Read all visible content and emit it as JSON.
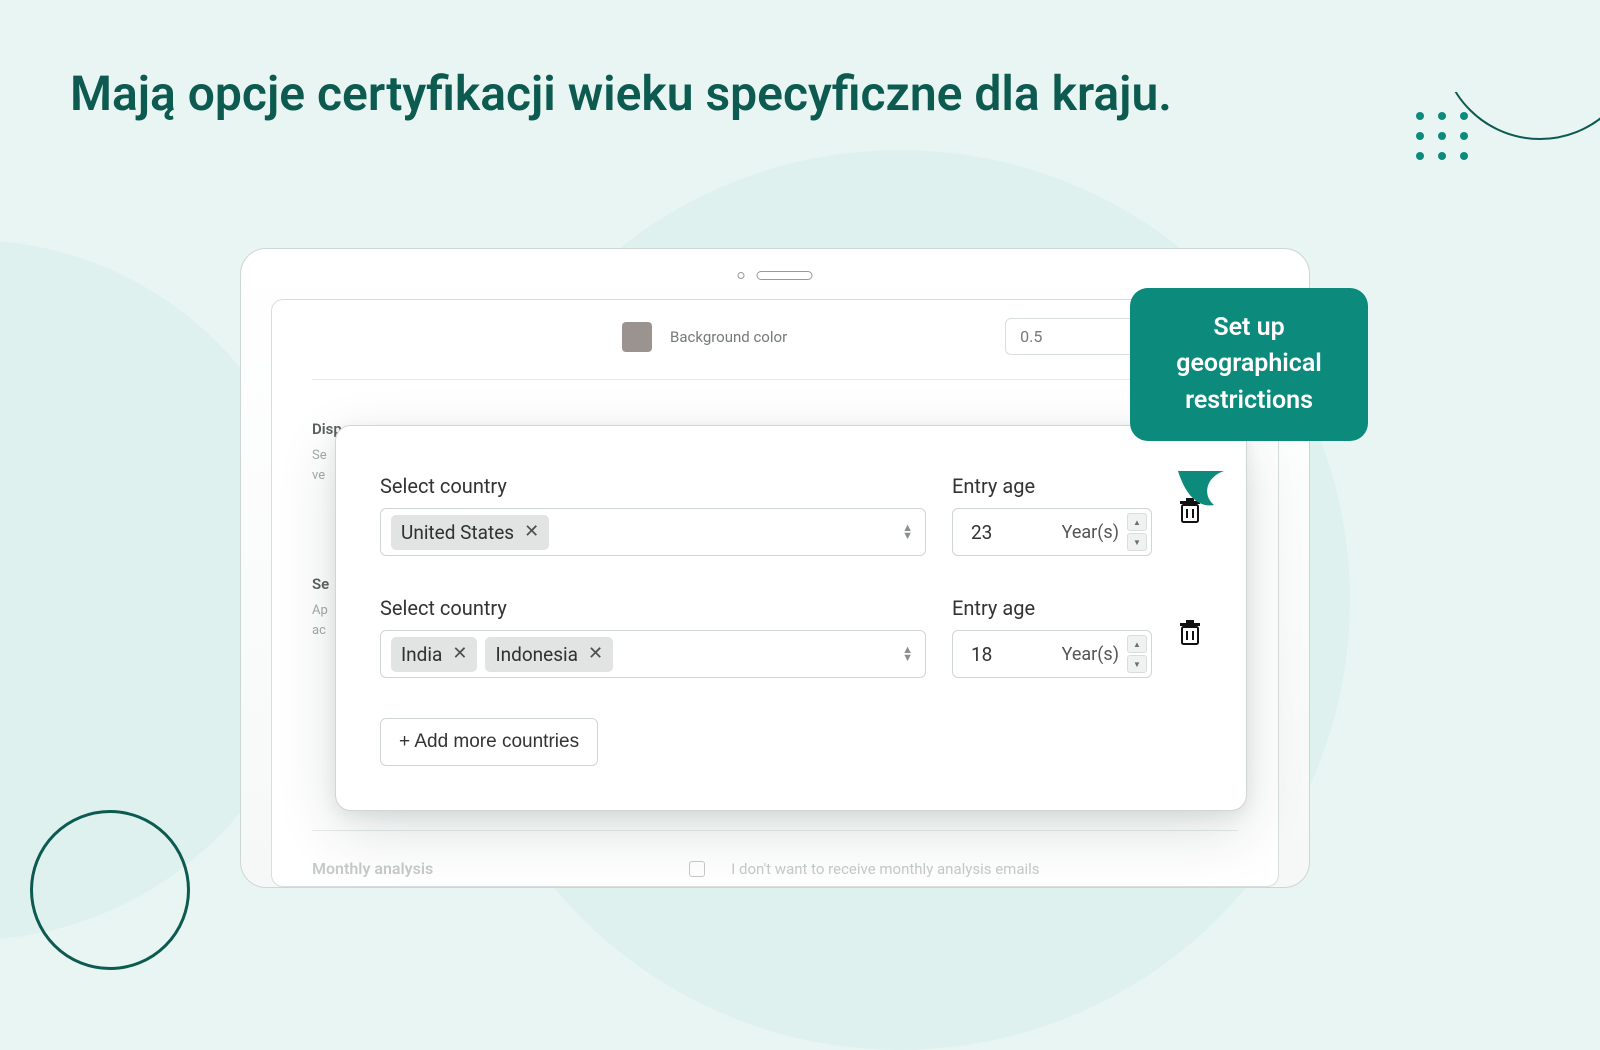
{
  "title": "Mają opcje certyfikacji wieku specyficzne dla kraju.",
  "callout": "Set up geographical restrictions",
  "bg_panel": {
    "swatch_label": "Background color",
    "opacity_value": "0.5",
    "disp_title_fragment": "Disp",
    "disp_desc_fragment_1": "Se",
    "disp_desc_fragment_2": "ve",
    "sec2_title_fragment": "Se",
    "sec2_desc_fragment_1": "Ap",
    "sec2_desc_fragment_2": "ac",
    "monthly_title": "Monthly analysis",
    "monthly_optout": "I don't want to receive monthly analysis emails"
  },
  "modal": {
    "country_label": "Select country",
    "age_label": "Entry age",
    "age_unit": "Year(s)",
    "add_button": "+ Add more countries",
    "rules": [
      {
        "countries": [
          "United States"
        ],
        "age": "23"
      },
      {
        "countries": [
          "India",
          "Indonesia"
        ],
        "age": "18"
      }
    ]
  }
}
